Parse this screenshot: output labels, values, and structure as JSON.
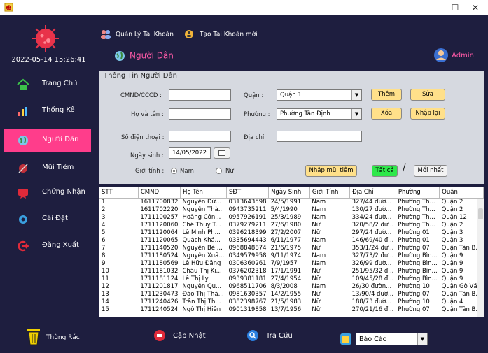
{
  "window": {
    "minimize": "—",
    "maximize": "☐",
    "close": "✕"
  },
  "sidebar": {
    "clock": "2022-05-14 15:26:41",
    "items": [
      {
        "label": "Trang Chủ"
      },
      {
        "label": "Thống Kê"
      },
      {
        "label": "Người Dân"
      },
      {
        "label": "Mũi Tiêm"
      },
      {
        "label": "Chứng Nhận"
      },
      {
        "label": "Cài Đặt"
      },
      {
        "label": "Đăng Xuất"
      }
    ],
    "trash_label": "Thùng Rác"
  },
  "header": {
    "manage_accounts": "Quản Lý Tài Khoản",
    "create_account": "Tạo Tài Khoản mới",
    "page_title": "Người Dân",
    "user": "Admin"
  },
  "form": {
    "legend": "Thông Tin Người Dân",
    "cmnd_label": "CMND/CCCD :",
    "name_label": "Họ và tên :",
    "phone_label": "Số điện thoại :",
    "dob_label": "Ngày sinh :",
    "gender_label": "Giới tính :",
    "district_label": "Quận :",
    "ward_label": "Phường :",
    "address_label": "Địa chỉ :",
    "cmnd_value": "",
    "name_value": "",
    "phone_value": "",
    "address_value": "",
    "dob_value": "14/05/2022",
    "district_value": "Quận 1",
    "ward_value": "Phường Tân Định",
    "male": "Nam",
    "female": "Nữ",
    "btn_add": "Thêm",
    "btn_edit": "Sửa",
    "btn_delete": "Xóa",
    "btn_reset": "Nhập lại",
    "btn_vaccine": "Nhập mũi tiêm",
    "btn_all": "Tất cả",
    "slash": "/",
    "btn_latest": "Mới nhất"
  },
  "table": {
    "columns": [
      "STT",
      "CMND",
      "Họ Tên",
      "SĐT",
      "Ngày Sinh",
      "Giới Tính",
      "Địa Chỉ",
      "Phường",
      "Quận"
    ],
    "rows": [
      [
        "1",
        "1611700832",
        "Nguyễn Đứ...",
        "0313643598",
        "24/5/1991",
        "Nam",
        "327/44 đườ...",
        "Phường Th...",
        "Quận 2"
      ],
      [
        "2",
        "1611702220",
        "Nguyễn Thà...",
        "0943735211",
        "5/4/1990",
        "Nam",
        "130/27 đườ...",
        "Phường Th...",
        "Quận 2"
      ],
      [
        "3",
        "1711100257",
        "Hoàng Côn...",
        "0957926191",
        "25/3/1989",
        "Nam",
        "334/24 đườ...",
        "Phường Th...",
        "Quận 12"
      ],
      [
        "4",
        "1711120060",
        "Chế Thuy T...",
        "0379279211",
        "27/6/1980",
        "Nữ",
        "320/58/2 đư...",
        "Phường Th...",
        "Quận 2"
      ],
      [
        "5",
        "1711120064",
        "Lê Minh Ph...",
        "0396218399",
        "27/2/2007",
        "Nữ",
        "297/24 đườ...",
        "Phường 01",
        "Quận 3"
      ],
      [
        "6",
        "1711120065",
        "Quách Khá...",
        "0335694443",
        "6/11/1977",
        "Nam",
        "146/69/40 đ...",
        "Phường 01",
        "Quận 3"
      ],
      [
        "7",
        "1711140520",
        "Nguyễn Bé ...",
        "0968848874",
        "21/6/1975",
        "Nữ",
        "353/1/24 đư...",
        "Phường 07",
        "Quận Tân B..."
      ],
      [
        "8",
        "1711180524",
        "Nguyễn Xuâ...",
        "0349579958",
        "9/11/1974",
        "Nam",
        "327/73/2 đư...",
        "Phường Bìn...",
        "Quận 9"
      ],
      [
        "9",
        "1711180569",
        "Lê Hữu Đăng",
        "0306360261",
        "7/9/1957",
        "Nam",
        "326/99 đườ...",
        "Phường Bìn...",
        "Quận 9"
      ],
      [
        "10",
        "1711181032",
        "Châu Thị Ki...",
        "0376202318",
        "17/1/1991",
        "Nữ",
        "251/95/32 đ...",
        "Phường Bìn...",
        "Quận 9"
      ],
      [
        "11",
        "1711181124",
        "Lê Thị Ly",
        "0939381181",
        "27/4/1954",
        "Nữ",
        "109/45/28 đ...",
        "Phường Bìn...",
        "Quận 9"
      ],
      [
        "12",
        "1711201817",
        "Nguyễn Qu...",
        "0968511706",
        "8/3/2008",
        "Nam",
        "26/30 đườn...",
        "Phường 10",
        "Quận Gò Vấp"
      ],
      [
        "13",
        "1711230473",
        "Đào Thị Thả...",
        "0981630357",
        "14/2/1955",
        "Nữ",
        "13/90/4 đườ...",
        "Phường 07",
        "Quận Tân B..."
      ],
      [
        "14",
        "1711240426",
        "Trần Thị Th...",
        "0382398767",
        "21/5/1983",
        "Nữ",
        "188/73 đườ...",
        "Phường 10",
        "Quận 4"
      ],
      [
        "15",
        "1711240524",
        "Ngô Thị Hiền",
        "0901319858",
        "13/7/1956",
        "Nữ",
        "270/21/16 đ...",
        "Phường 07",
        "Quận Tân B..."
      ]
    ]
  },
  "bottom": {
    "update": "Cập Nhật",
    "search": "Tra Cứu",
    "report": "Báo Cáo"
  },
  "colors": {
    "sidebar_bg": "#1e1e3f",
    "accent": "#ff3d8b"
  }
}
